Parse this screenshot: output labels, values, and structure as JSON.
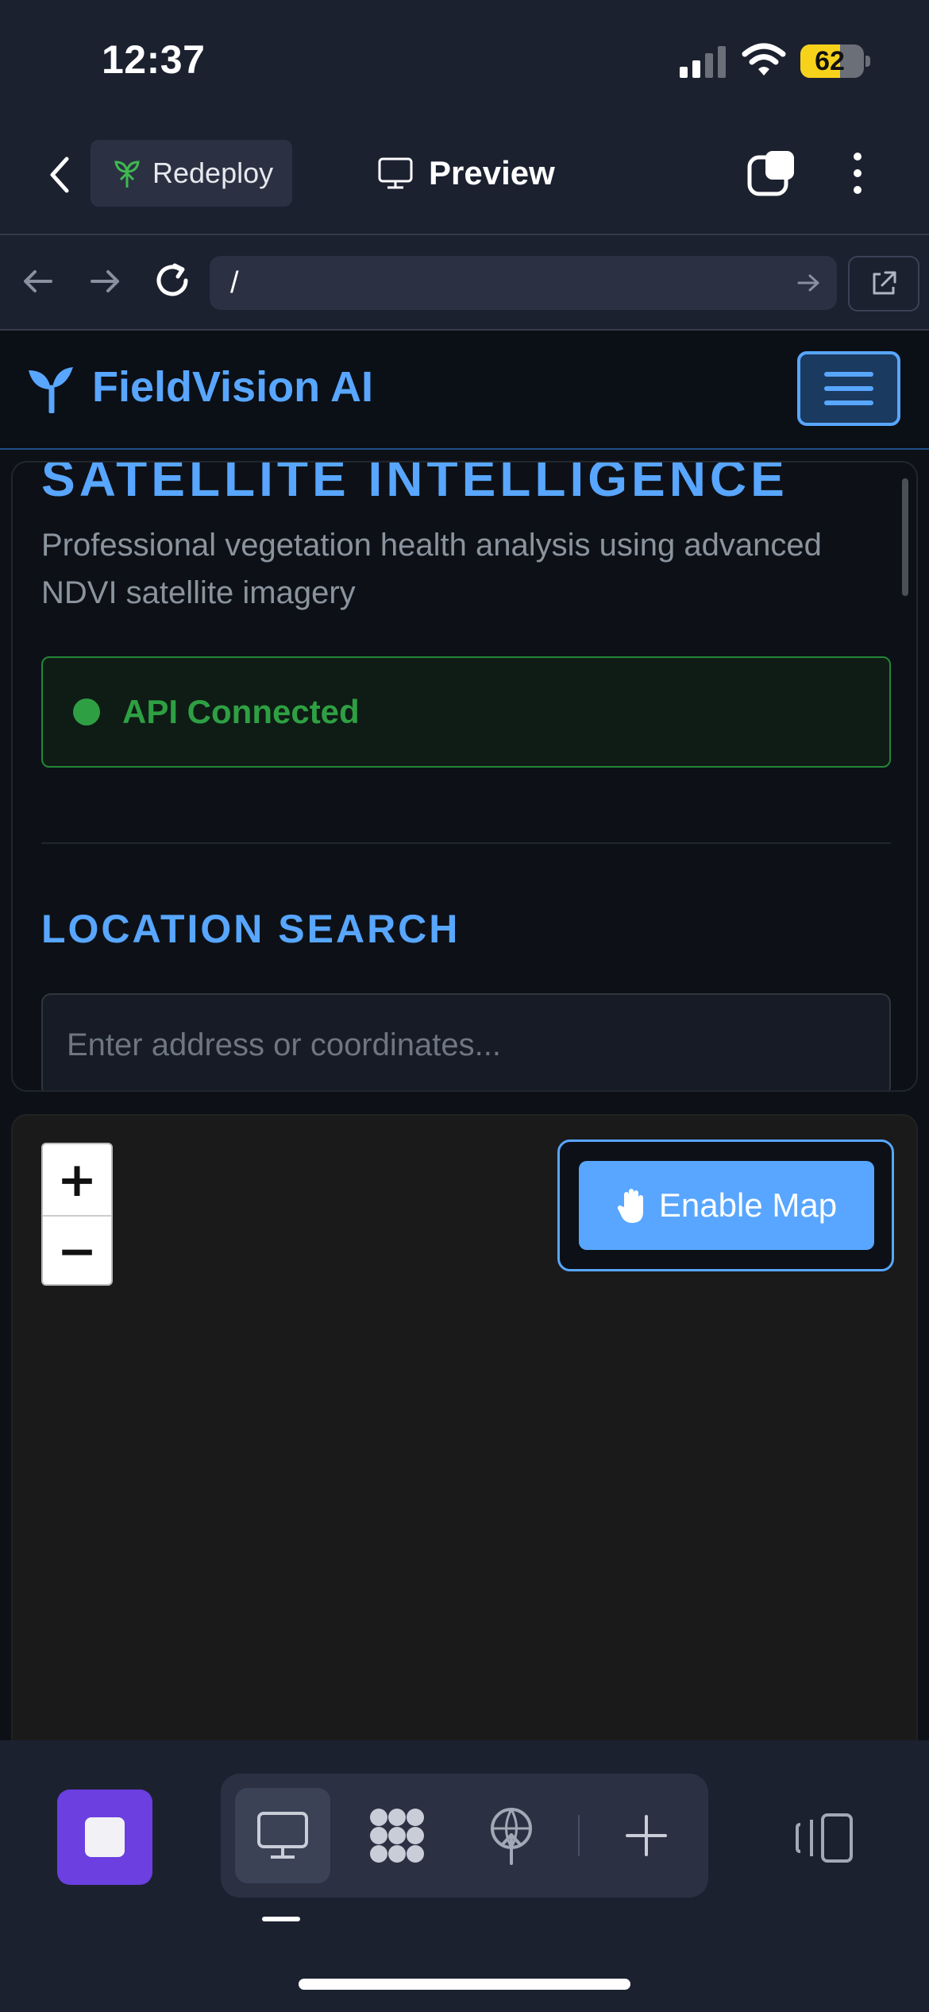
{
  "status_bar": {
    "time": "12:37",
    "battery": "62",
    "battery_level": 0.62
  },
  "app_bar": {
    "redeploy_label": "Redeploy",
    "preview_label": "Preview"
  },
  "browser": {
    "url": "/"
  },
  "site": {
    "brand": "FieldVision AI",
    "hero_title": "SATELLITE INTELLIGENCE",
    "hero_description": "Professional vegetation health analysis using advanced NDVI satellite imagery",
    "api_status": "API Connected",
    "location_title": "LOCATION SEARCH",
    "location_placeholder": "Enter address or coordinates..."
  },
  "map": {
    "zoom_in": "+",
    "zoom_out": "−",
    "enable_label": "Enable Map"
  },
  "colors": {
    "accent": "#58a6ff",
    "success": "#2ea043",
    "stop": "#6b3fe0",
    "chrome": "#1c2130"
  },
  "icons": {
    "back": "chevron-left-icon",
    "redeploy": "sprout-icon",
    "preview": "monitor-icon",
    "tabs": "tabs-icon",
    "more": "more-vertical-icon",
    "reload": "reload-icon",
    "open_external": "external-link-icon",
    "logo": "seedling-icon",
    "menu": "hamburger-icon",
    "hand": "hand-icon",
    "stop": "stop-icon",
    "monitor": "monitor-icon",
    "apps": "apps-icon",
    "deploy": "deploy-icon",
    "add": "plus-icon",
    "panel": "side-panel-icon"
  }
}
